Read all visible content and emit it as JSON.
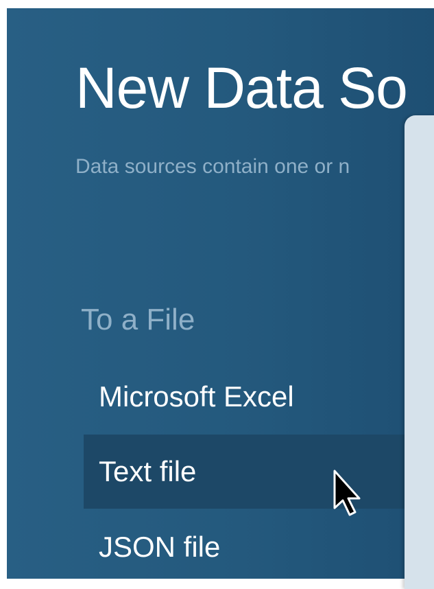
{
  "dialog": {
    "title": "New Data So",
    "subtitle": "Data sources contain one or n"
  },
  "to_a_file": {
    "heading": "To a File",
    "items": [
      {
        "label": "Microsoft Excel",
        "selected": false
      },
      {
        "label": "Text file",
        "selected": true
      },
      {
        "label": "JSON file",
        "selected": false
      }
    ]
  },
  "icons": {
    "cursor": "arrow-cursor-icon"
  },
  "colors": {
    "panel_background": "#285f84",
    "selected_item": "#1d4867",
    "muted_text": "#8fb0c8",
    "overlay_panel": "#d6e2eb"
  }
}
